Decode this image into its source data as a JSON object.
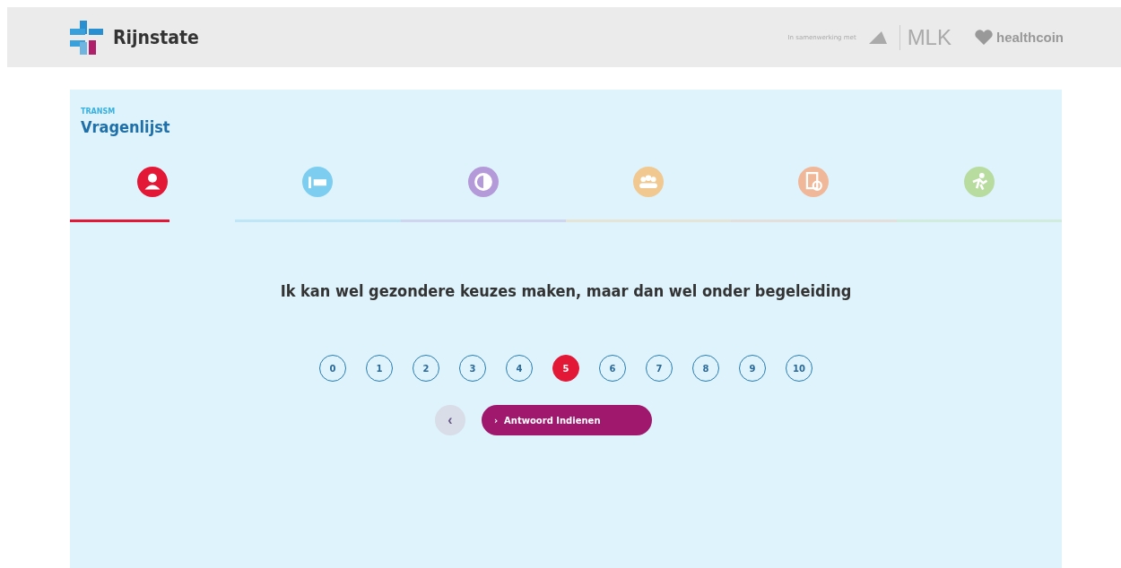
{
  "header": {
    "brand": "Rijnstate",
    "partner_note": "In samenwerking met",
    "partner_logo": "MLK",
    "partner_brand": "healthcoin"
  },
  "card": {
    "eyebrow": "TRANSM",
    "title": "Vragenlijst"
  },
  "steps": [
    {
      "kind": "person",
      "color": "#e31837",
      "selected": true
    },
    {
      "kind": "bed",
      "color": "#7dcdf0",
      "selected": false
    },
    {
      "kind": "half",
      "color": "#b49ad8",
      "selected": false
    },
    {
      "kind": "group",
      "color": "#f0c890",
      "selected": false
    },
    {
      "kind": "document",
      "color": "#f0b898",
      "selected": false
    },
    {
      "kind": "runner",
      "color": "#b8dca0",
      "selected": false
    }
  ],
  "question": "Ik kan wel gezondere keuzes maken, maar dan wel onder begeleiding",
  "scale": [
    {
      "label": "0",
      "selected": false
    },
    {
      "label": "1",
      "selected": false
    },
    {
      "label": "2",
      "selected": false
    },
    {
      "label": "3",
      "selected": false
    },
    {
      "label": "4",
      "selected": false
    },
    {
      "label": "5",
      "selected": true
    },
    {
      "label": "6",
      "selected": false
    },
    {
      "label": "7",
      "selected": false
    },
    {
      "label": "8",
      "selected": false
    },
    {
      "label": "9",
      "selected": false
    },
    {
      "label": "10",
      "selected": false
    }
  ],
  "back_button": "‹",
  "submit_button": {
    "icon": "›",
    "label": "Antwoord Indienen"
  }
}
